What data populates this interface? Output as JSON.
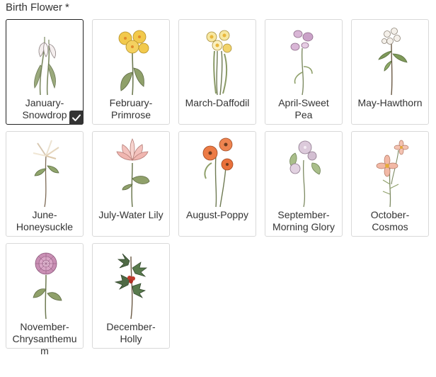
{
  "field": {
    "label": "Birth Flower",
    "required_mark": "*"
  },
  "selected_index": 0,
  "colors": {
    "selected_border": "#222222",
    "card_border": "#d9d9d9",
    "check_bg": "#333333"
  },
  "flowers": [
    {
      "label": "January-Snowdrop",
      "line1": "January-",
      "line2": "Snowdrop",
      "line3": "",
      "icon": "snowdrop-illustration"
    },
    {
      "label": "February-Primrose",
      "line1": "February-",
      "line2": "Primrose",
      "line3": "",
      "icon": "primrose-illustration"
    },
    {
      "label": "March-Daffodil",
      "line1": "March-Daffodil",
      "line2": "",
      "line3": "",
      "icon": "daffodil-illustration"
    },
    {
      "label": "April-Sweet Pea",
      "line1": "April-Sweet",
      "line2": "Pea",
      "line3": "",
      "icon": "sweet-pea-illustration"
    },
    {
      "label": "May-Hawthorn",
      "line1": "May-Hawthorn",
      "line2": "",
      "line3": "",
      "icon": "hawthorn-illustration"
    },
    {
      "label": "June-Honeysuckle",
      "line1": "June-",
      "line2": "Honeysuckle",
      "line3": "",
      "icon": "honeysuckle-illustration"
    },
    {
      "label": "July-Water Lily",
      "line1": "July-Water Lily",
      "line2": "",
      "line3": "",
      "icon": "water-lily-illustration"
    },
    {
      "label": "August-Poppy",
      "line1": "August-Poppy",
      "line2": "",
      "line3": "",
      "icon": "poppy-illustration"
    },
    {
      "label": "September-Morning Glory",
      "line1": "September-",
      "line2": "Morning Glory",
      "line3": "",
      "icon": "morning-glory-illustration"
    },
    {
      "label": "October-Cosmos",
      "line1": "October-",
      "line2": "Cosmos",
      "line3": "",
      "icon": "cosmos-illustration"
    },
    {
      "label": "November-Chrysanthemum",
      "line1": "November-",
      "line2": "Chrysanthemu",
      "line3": "m",
      "icon": "chrysanthemum-illustration"
    },
    {
      "label": "December-Holly",
      "line1": "December-",
      "line2": "Holly",
      "line3": "",
      "icon": "holly-illustration"
    }
  ]
}
